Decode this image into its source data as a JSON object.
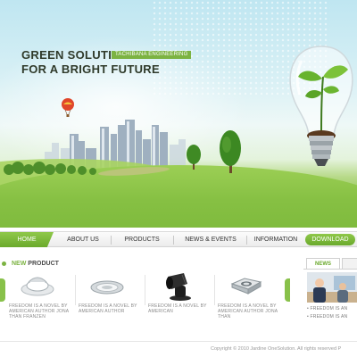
{
  "hero": {
    "title_line1": "GREEN SOLUTION",
    "badge": "TACHIBANA ENGINEERING",
    "title_line2": "FOR A BRIGHT FUTURE"
  },
  "nav": {
    "items": [
      "HOME",
      "ABOUT US",
      "PRODUCTS",
      "NEWS & EVENTS",
      "INFORMATION"
    ],
    "download": "DOWNLOAD"
  },
  "new_product": {
    "label_accent": "NEW",
    "label_rest": " PRODUCT",
    "items": [
      {
        "icon": "recessed-light-icon",
        "caption": "FREEDOM IS A NOVEL BY AMERICAN AUTHOR JONA THAN FRANZEN"
      },
      {
        "icon": "downlight-icon",
        "caption": "FREEDOM IS A NOVEL BY AMERICAN AUTHOR"
      },
      {
        "icon": "spotlight-icon",
        "caption": "FREEDOM IS A NOVEL BY AMERICAN"
      },
      {
        "icon": "square-downlight-icon",
        "caption": "FREEDOM IS A NOVEL BY AMERICAN AUTHOR JONA THAN"
      }
    ]
  },
  "news": {
    "tab": "NEWS",
    "items": [
      "FREEDOM IS AN",
      "FREEDOM IS AN"
    ]
  },
  "footer": {
    "copyright": "Copyright © 2010 Jardine OneSolution. All rights reserved P"
  },
  "colors": {
    "accent_green": "#7cb342",
    "nav_green": "#6aa92c",
    "title_dark": "#2f3a2a"
  }
}
